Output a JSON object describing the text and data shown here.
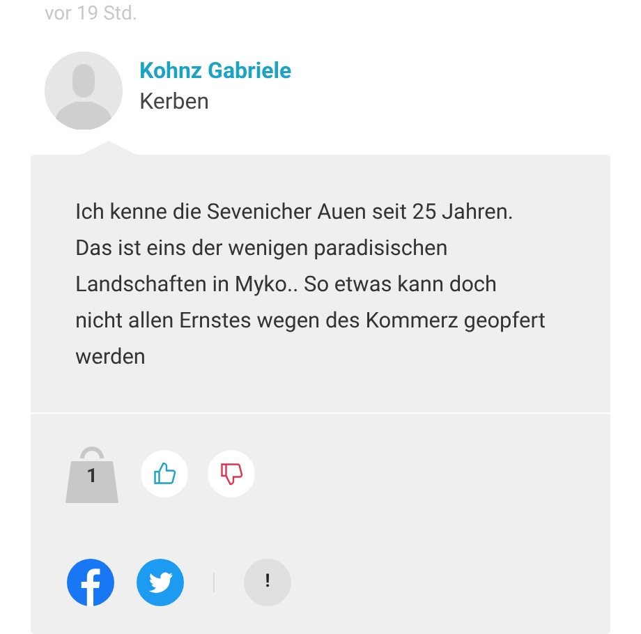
{
  "timestamp": "vor 19 Std.",
  "comment": {
    "author": "Kohnz Gabriele",
    "location": "Kerben",
    "text": "Ich kenne die Sevenicher Auen seit 25 Jahren. Das ist eins der wenigen paradisischen Landschaften in Myko.. So etwas kann doch nicht allen Ernstes wegen des Kommerz geopfert werden",
    "weight": "1",
    "report": "!"
  }
}
